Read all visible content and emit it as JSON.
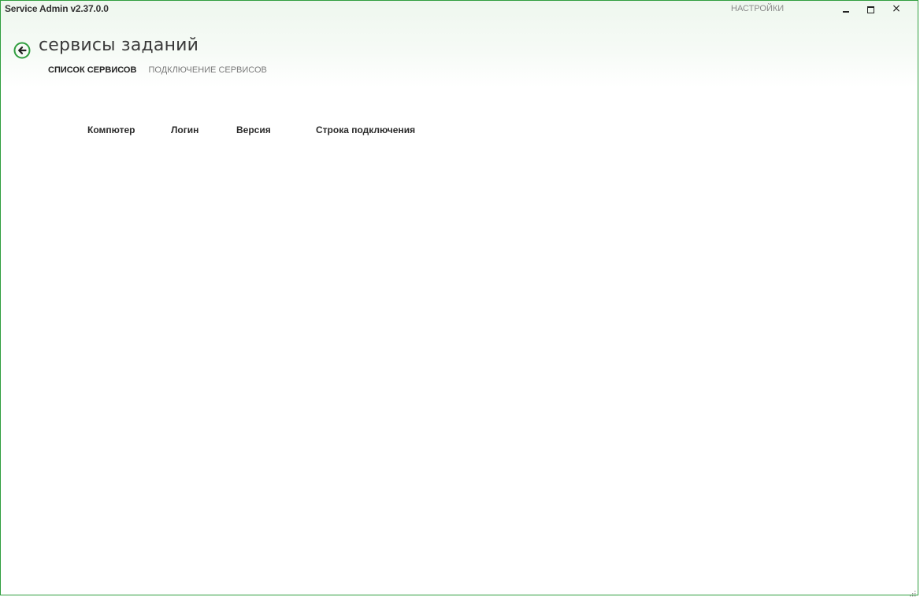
{
  "window": {
    "app_title": "Service Admin  v2.37.0.0",
    "settings_label": "НАСТРОЙКИ",
    "accent_color": "#2f9e3e"
  },
  "header": {
    "back_icon": "arrow-left-circle-icon",
    "page_title": "сервисы заданий"
  },
  "tabs": [
    {
      "label": "СПИСОК СЕРВИСОВ",
      "active": true
    },
    {
      "label": "ПОДКЛЮЧЕНИЕ СЕРВИСОВ",
      "active": false
    }
  ],
  "grid": {
    "columns": [
      {
        "label": "Компютер"
      },
      {
        "label": "Логин"
      },
      {
        "label": "Версия"
      },
      {
        "label": "Строка подключения"
      }
    ],
    "rows": []
  }
}
